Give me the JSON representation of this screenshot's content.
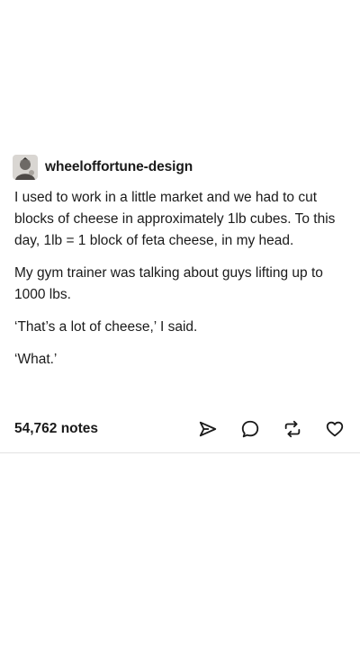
{
  "post": {
    "username": "wheeloffortune-design",
    "paragraphs": [
      "I used to work in a little market and we had to cut blocks of cheese in approximately 1lb cubes. To this day, 1lb = 1 block of feta cheese, in my head.",
      "My gym trainer was talking about guys lifting up to 1000 lbs.",
      "‘That’s a lot of cheese,’ I said.",
      "‘What.’"
    ],
    "notes": "54,762 notes"
  },
  "icons": {
    "avatar": "avatar-icon",
    "share": "share-icon",
    "reply": "reply-icon",
    "reblog": "reblog-icon",
    "like": "heart-icon"
  },
  "colors": {
    "text": "#1a1a1a",
    "divider": "#e2e2e2"
  }
}
